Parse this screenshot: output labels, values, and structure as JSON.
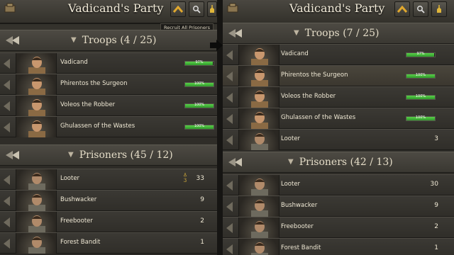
{
  "left": {
    "title": "Vadicand's Party",
    "tooltip": "Recruit All Prisoners",
    "troops_label": "Troops",
    "troops_count": "(4 / 25)",
    "prisoners_label": "Prisoners",
    "prisoners_count": "(45 / 12)",
    "troops": [
      {
        "name": "Vadicand",
        "hp": 97,
        "hp_label": "97%"
      },
      {
        "name": "Phirentos the Surgeon",
        "hp": 100,
        "hp_label": "100%"
      },
      {
        "name": "Voleos the Robber",
        "hp": 100,
        "hp_label": "100%"
      },
      {
        "name": "Ghulassen of the Wastes",
        "hp": 100,
        "hp_label": "100%"
      }
    ],
    "prisoners": [
      {
        "name": "Looter",
        "count": "33",
        "upgrade": "3"
      },
      {
        "name": "Bushwacker",
        "count": "9"
      },
      {
        "name": "Freebooter",
        "count": "2"
      },
      {
        "name": "Forest Bandit",
        "count": "1"
      }
    ]
  },
  "right": {
    "title": "Vadicand's Party",
    "troops_label": "Troops",
    "troops_count": "(7 / 25)",
    "prisoners_label": "Prisoners",
    "prisoners_count": "(42 / 13)",
    "troops": [
      {
        "name": "Vadicand",
        "hp": 97,
        "hp_label": "97%"
      },
      {
        "name": "Phirentos the Surgeon",
        "hp": 100,
        "hp_label": "100%"
      },
      {
        "name": "Voleos the Robber",
        "hp": 100,
        "hp_label": "100%"
      },
      {
        "name": "Ghulassen of the Wastes",
        "hp": 100,
        "hp_label": "100%"
      },
      {
        "name": "Looter",
        "count": "3"
      }
    ],
    "prisoners": [
      {
        "name": "Looter",
        "count": "30"
      },
      {
        "name": "Bushwacker",
        "count": "9"
      },
      {
        "name": "Freebooter",
        "count": "2"
      },
      {
        "name": "Forest Bandit",
        "count": "1"
      }
    ]
  },
  "icons": {
    "up": "chevron-up-icon",
    "search": "search-icon",
    "recruit": "recruit-all-icon",
    "collapse": "collapse-left-icon",
    "arrow": "arrow-right-icon"
  },
  "colors": {
    "hp_bar": "#3fb83a",
    "accent_gold": "#e0b63a",
    "panel_bg": "#2f2d28"
  }
}
